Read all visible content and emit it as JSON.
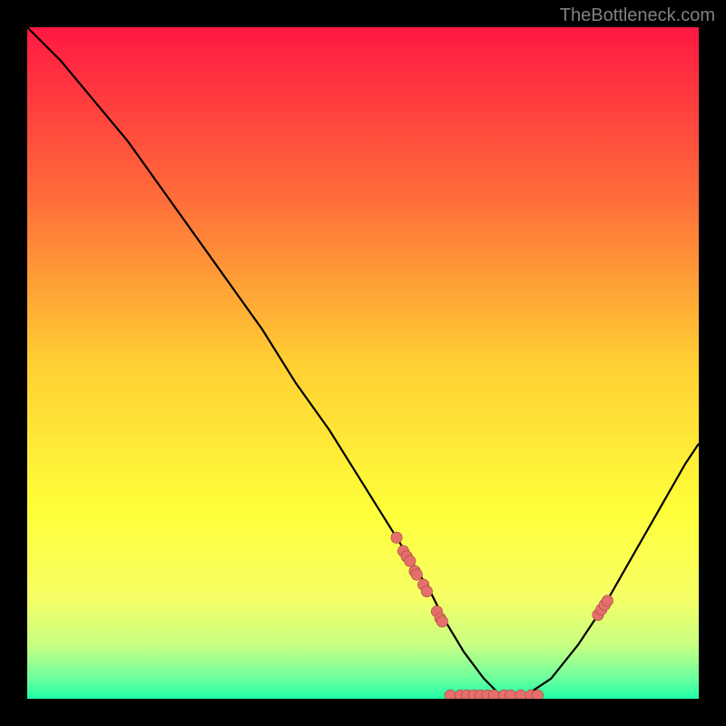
{
  "watermark": "TheBottleneck.com",
  "chart_data": {
    "type": "line",
    "title": "",
    "xlabel": "",
    "ylabel": "",
    "xlim": [
      0,
      100
    ],
    "ylim": [
      0,
      100
    ],
    "series": [
      {
        "name": "curve",
        "x": [
          0,
          5,
          10,
          15,
          20,
          25,
          30,
          35,
          40,
          45,
          50,
          55,
          60,
          62,
          65,
          68,
          70,
          72,
          75,
          78,
          82,
          86,
          90,
          94,
          98,
          100
        ],
        "values": [
          100,
          95,
          89,
          83,
          76,
          69,
          62,
          55,
          47,
          40,
          32,
          24,
          16,
          12,
          7,
          3,
          1,
          0,
          1,
          3,
          8,
          14,
          21,
          28,
          35,
          38
        ]
      }
    ],
    "points": [
      {
        "x": 55,
        "y": 24
      },
      {
        "x": 56,
        "y": 22
      },
      {
        "x": 56.5,
        "y": 21.2
      },
      {
        "x": 57,
        "y": 20.5
      },
      {
        "x": 57.7,
        "y": 19
      },
      {
        "x": 58,
        "y": 18.5
      },
      {
        "x": 59,
        "y": 17
      },
      {
        "x": 59.5,
        "y": 16
      },
      {
        "x": 61,
        "y": 13
      },
      {
        "x": 61.5,
        "y": 12
      },
      {
        "x": 61.8,
        "y": 11.5
      },
      {
        "x": 63,
        "y": 0.5
      },
      {
        "x": 64.5,
        "y": 0.5
      },
      {
        "x": 65.5,
        "y": 0.5
      },
      {
        "x": 66.5,
        "y": 0.5
      },
      {
        "x": 67.5,
        "y": 0.5
      },
      {
        "x": 68.5,
        "y": 0.5
      },
      {
        "x": 69.5,
        "y": 0.5
      },
      {
        "x": 71,
        "y": 0.5
      },
      {
        "x": 72,
        "y": 0.5
      },
      {
        "x": 73.5,
        "y": 0.5
      },
      {
        "x": 75,
        "y": 0.5
      },
      {
        "x": 76,
        "y": 0.5
      },
      {
        "x": 85,
        "y": 12.5
      },
      {
        "x": 85.5,
        "y": 13.3
      },
      {
        "x": 86,
        "y": 14
      },
      {
        "x": 86.4,
        "y": 14.6
      }
    ],
    "gradient_stops": [
      {
        "offset": 0.0,
        "color": "#ff1842"
      },
      {
        "offset": 0.25,
        "color": "#ff6b3a"
      },
      {
        "offset": 0.5,
        "color": "#ffcf33"
      },
      {
        "offset": 0.72,
        "color": "#ffff3a"
      },
      {
        "offset": 0.85,
        "color": "#f6ff66"
      },
      {
        "offset": 0.92,
        "color": "#c8ff82"
      },
      {
        "offset": 0.97,
        "color": "#6bff9e"
      },
      {
        "offset": 1.0,
        "color": "#1effa7"
      }
    ],
    "point_fill": "#e46f6b",
    "point_stroke": "#a64240",
    "curve_stroke": "#000000"
  }
}
